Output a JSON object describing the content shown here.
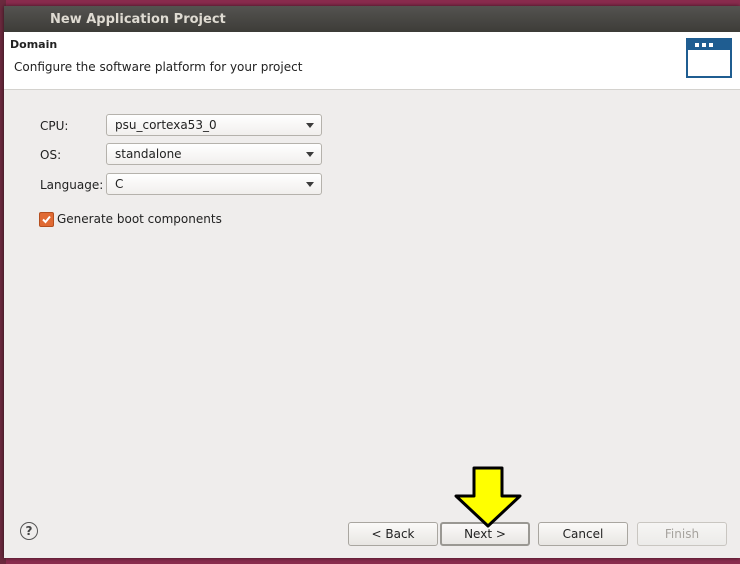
{
  "window": {
    "title": "New Application Project"
  },
  "header": {
    "title": "Domain",
    "description": "Configure the software platform for your project",
    "icon": "wizard-banner-icon"
  },
  "form": {
    "cpu": {
      "label": "CPU:",
      "value": "psu_cortexa53_0"
    },
    "os": {
      "label": "OS:",
      "value": "standalone"
    },
    "language": {
      "label": "Language:",
      "value": "C"
    },
    "boot": {
      "label": "Generate boot components",
      "checked": true
    }
  },
  "footer": {
    "help": "?",
    "back": "< Back",
    "next": "Next >",
    "cancel": "Cancel",
    "finish": "Finish"
  },
  "colors": {
    "accent": "#e06a33",
    "overlay_arrow": "#ffff00",
    "icon_blue": "#1f5d91"
  }
}
